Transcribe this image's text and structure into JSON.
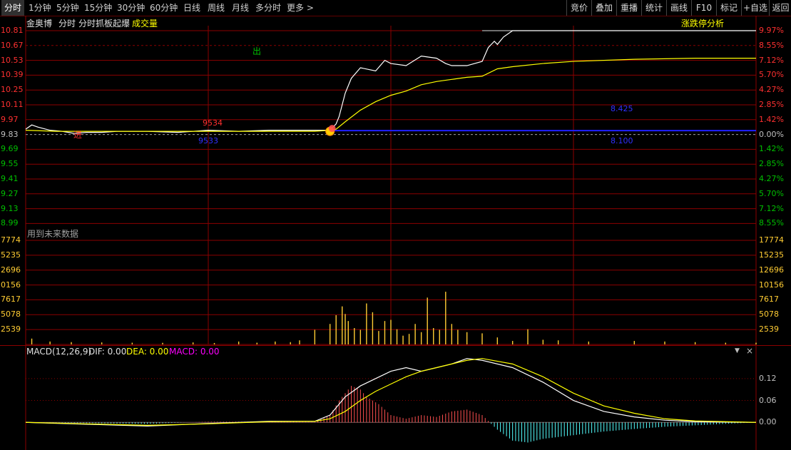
{
  "toolbar": {
    "left_tabs": [
      "分时",
      "1分钟",
      "5分钟",
      "15分钟",
      "30分钟",
      "60分钟",
      "日线",
      "周线",
      "月线",
      "多分时",
      "更多 >"
    ],
    "right_buttons": [
      "竞价",
      "叠加",
      "重播",
      "统计",
      "画线",
      "F10",
      "标记",
      "+自选",
      "返回"
    ]
  },
  "price_panel": {
    "stock_name": "金奥博",
    "chart_mode": "分时",
    "indicator_name": "分时抓板起爆",
    "volume_label": "成交量",
    "analysis_button": "涨跌停分析",
    "future_data_note": "用到未来数据",
    "left_ticks": [
      "10.81",
      "10.67",
      "10.53",
      "10.39",
      "10.25",
      "10.11",
      "9.97",
      "9.83",
      "9.69",
      "9.55",
      "9.41",
      "9.27",
      "9.13",
      "8.99"
    ],
    "right_ticks": [
      "9.97%",
      "8.55%",
      "7.12%",
      "5.70%",
      "4.27%",
      "2.85%",
      "1.42%",
      "0.00%",
      "1.42%",
      "2.85%",
      "4.27%",
      "5.70%",
      "7.12%",
      "8.55%"
    ],
    "annotations": {
      "buy_marker": "进",
      "sell_marker": "出",
      "label_a": "9534",
      "label_b": "9533",
      "label_c": "8.425",
      "label_d": "8.100"
    }
  },
  "volume_panel": {
    "left_ticks": [
      "7774",
      "5235",
      "2696",
      "0156",
      "7617",
      "5078",
      "2539"
    ],
    "right_ticks": [
      "17774",
      "15235",
      "12696",
      "10156",
      "7617",
      "5078",
      "2539"
    ]
  },
  "macd_panel": {
    "title": "MACD(12,26,9)",
    "dif_label": "DIF: 0.00",
    "dea_label": "DEA: 0.00",
    "macd_label": "MACD: 0.00",
    "right_ticks": [
      "0.12",
      "0.06",
      "0.00"
    ],
    "menu_icon": "▼",
    "close_icon": "×"
  },
  "chart_data": [
    {
      "type": "line",
      "name": "intraday_price",
      "y_range": [
        8.99,
        10.81
      ],
      "prev_close": 9.83,
      "limit_up": 10.81,
      "series": [
        {
          "name": "price",
          "color": "#ffffff",
          "x": [
            0,
            2,
            4,
            8,
            12,
            16,
            20,
            25,
            30,
            40,
            50,
            60,
            70,
            80,
            90,
            95,
            100,
            102,
            103,
            105,
            107,
            110,
            115,
            118,
            120,
            125,
            130,
            135,
            138,
            140,
            145,
            150,
            152,
            154,
            155,
            157,
            160,
            170,
            200,
            240
          ],
          "y": [
            9.88,
            9.92,
            9.9,
            9.87,
            9.86,
            9.84,
            9.85,
            9.85,
            9.86,
            9.86,
            9.85,
            9.87,
            9.86,
            9.87,
            9.87,
            9.87,
            9.87,
            9.93,
            10.0,
            10.22,
            10.36,
            10.46,
            10.43,
            10.53,
            10.5,
            10.48,
            10.57,
            10.55,
            10.5,
            10.48,
            10.48,
            10.52,
            10.65,
            10.71,
            10.68,
            10.75,
            10.81,
            10.81,
            10.81,
            10.81
          ]
        },
        {
          "name": "avg_price",
          "color": "#ffff00",
          "x": [
            0,
            10,
            20,
            30,
            40,
            50,
            60,
            70,
            80,
            90,
            95,
            100,
            102,
            105,
            110,
            115,
            120,
            125,
            130,
            135,
            140,
            145,
            150,
            155,
            160,
            170,
            180,
            200,
            220,
            240
          ],
          "y": [
            9.87,
            9.86,
            9.86,
            9.86,
            9.86,
            9.86,
            9.86,
            9.86,
            9.86,
            9.86,
            9.86,
            9.87,
            9.88,
            9.95,
            10.06,
            10.14,
            10.2,
            10.24,
            10.3,
            10.33,
            10.35,
            10.37,
            10.38,
            10.45,
            10.47,
            10.5,
            10.52,
            10.54,
            10.55,
            10.55
          ]
        }
      ]
    },
    {
      "type": "bar",
      "name": "volume",
      "y_range": [
        0,
        17774
      ],
      "x": [
        2,
        8,
        15,
        25,
        35,
        45,
        55,
        62,
        70,
        76,
        82,
        87,
        90,
        95,
        100,
        102,
        104,
        105,
        106,
        108,
        110,
        112,
        114,
        116,
        118,
        120,
        122,
        124,
        126,
        128,
        130,
        132,
        134,
        136,
        138,
        140,
        142,
        145,
        150,
        155,
        160,
        165,
        170,
        175,
        185,
        200,
        210,
        220,
        230,
        240
      ],
      "values": [
        1000,
        500,
        400,
        350,
        300,
        280,
        350,
        250,
        500,
        300,
        500,
        400,
        700,
        2500,
        3500,
        5000,
        6500,
        5200,
        4000,
        2800,
        2500,
        7000,
        5500,
        2300,
        4000,
        4200,
        2600,
        1500,
        1800,
        3500,
        2100,
        8000,
        2800,
        2500,
        9000,
        3500,
        2500,
        2100,
        1900,
        1200,
        600,
        2600,
        800,
        700,
        500,
        600,
        500,
        400,
        300,
        300
      ]
    },
    {
      "type": "line",
      "name": "macd",
      "y_range": [
        -0.06,
        0.19
      ],
      "series": [
        {
          "name": "DIF",
          "color": "#ffffff",
          "x": [
            0,
            20,
            40,
            60,
            80,
            95,
            100,
            105,
            110,
            115,
            120,
            125,
            130,
            135,
            140,
            145,
            150,
            160,
            170,
            180,
            190,
            200,
            210,
            220,
            240
          ],
          "y": [
            0,
            -0.005,
            -0.01,
            -0.003,
            0.003,
            0.003,
            0.02,
            0.07,
            0.1,
            0.12,
            0.14,
            0.15,
            0.14,
            0.15,
            0.16,
            0.175,
            0.17,
            0.15,
            0.11,
            0.06,
            0.03,
            0.015,
            0.006,
            0.002,
            0
          ]
        },
        {
          "name": "DEA",
          "color": "#ffff00",
          "x": [
            0,
            20,
            40,
            60,
            80,
            95,
            100,
            105,
            110,
            115,
            120,
            125,
            130,
            135,
            140,
            145,
            150,
            160,
            170,
            180,
            190,
            200,
            210,
            220,
            240
          ],
          "y": [
            0,
            -0.004,
            -0.008,
            -0.004,
            0.002,
            0.003,
            0.01,
            0.03,
            0.06,
            0.085,
            0.105,
            0.125,
            0.14,
            0.15,
            0.16,
            0.17,
            0.175,
            0.16,
            0.125,
            0.08,
            0.045,
            0.025,
            0.01,
            0.004,
            0
          ]
        },
        {
          "name": "MACD",
          "color": "mixed",
          "x": [
            0,
            20,
            40,
            60,
            80,
            95,
            100,
            103,
            105,
            107,
            110,
            112,
            114,
            116,
            118,
            120,
            125,
            130,
            135,
            140,
            145,
            150,
            155,
            160,
            165,
            170,
            175,
            180,
            190,
            200,
            210,
            220,
            230,
            240
          ],
          "y": [
            0,
            -0.002,
            -0.004,
            0.002,
            0.002,
            0.001,
            0.02,
            0.06,
            0.08,
            0.1,
            0.09,
            0.07,
            0.06,
            0.05,
            0.035,
            0.02,
            0.01,
            0.02,
            0.015,
            0.03,
            0.035,
            0.02,
            -0.02,
            -0.05,
            -0.055,
            -0.045,
            -0.04,
            -0.035,
            -0.025,
            -0.018,
            -0.012,
            -0.008,
            -0.004,
            0
          ]
        }
      ]
    }
  ],
  "colors": {
    "grid": "#8b0000",
    "up": "#ff3030",
    "down": "#00c000",
    "price_line": "#ffffff",
    "avg_line": "#ffff00",
    "neutral_text": "#c0c0c0",
    "dif": "#ffffff",
    "dea": "#ffff00",
    "macd": "#ff00ff",
    "hist_up": "#ff5050",
    "hist_down": "#54ffff",
    "marker_blue": "#2020ff"
  }
}
